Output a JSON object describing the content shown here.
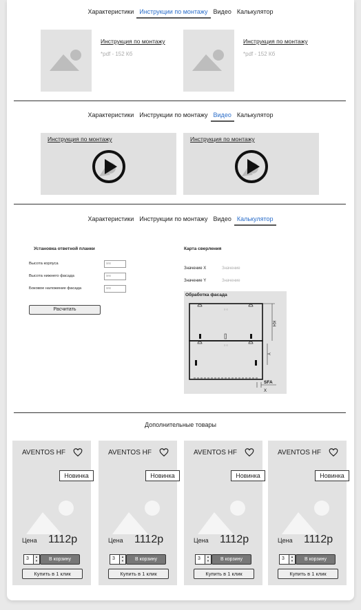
{
  "tabs": [
    "Характеристики",
    "Инструкции по монтажу",
    "Видео",
    "Калькулятор"
  ],
  "section1": {
    "active_tab": 1,
    "docs": [
      {
        "title": "Инструкция по монтажу",
        "meta": "*pdf - 152 Кб"
      },
      {
        "title": "Инструкция по монтажу",
        "meta": "*pdf - 152 Кб"
      }
    ]
  },
  "section2": {
    "active_tab": 2,
    "videos": [
      {
        "title": "Инструкция по монтажу"
      },
      {
        "title": "Инструкция по монтажу"
      }
    ]
  },
  "section3": {
    "active_tab": 3,
    "calc_title": "Установка ответной планки",
    "fields": [
      {
        "label": "Высота корпуса",
        "placeholder": "мм"
      },
      {
        "label": "Высота нижнего фасада",
        "placeholder": "мм"
      },
      {
        "label": "Боковое наложение фасада",
        "placeholder": "мм"
      }
    ],
    "calc_button": "Расчитать",
    "map_title": "Карта сверления",
    "values": [
      {
        "label": "Значение X",
        "value": "Значение"
      },
      {
        "label": "Значение Y",
        "value": "Значение"
      }
    ],
    "diagram": {
      "title": "Обработка фасада",
      "labels": {
        "kh": "KH",
        "y": "Y",
        "sfa": "SFA",
        "x": "X"
      }
    }
  },
  "extra": {
    "title": "Дополнительные товары",
    "products": [
      {
        "name": "AVENTOS HF",
        "badge": "Новинка",
        "price_label": "Цена",
        "price": "1112р",
        "qty": "3",
        "cart": "В корзину",
        "oneclick": "Купить в 1 клик"
      },
      {
        "name": "AVENTOS HF",
        "badge": "Новинка",
        "price_label": "Цена",
        "price": "1112р",
        "qty": "3",
        "cart": "В корзину",
        "oneclick": "Купить в 1 клик"
      },
      {
        "name": "AVENTOS HF",
        "badge": "Новинка",
        "price_label": "Цена",
        "price": "1112р",
        "qty": "3",
        "cart": "В корзину",
        "oneclick": "Купить в 1 клик"
      },
      {
        "name": "AVENTOS HF",
        "badge": "Новинка",
        "price_label": "Цена",
        "price": "1112р",
        "qty": "3",
        "cart": "В корзину",
        "oneclick": "Купить в 1 клик"
      }
    ]
  },
  "colors": {
    "accent": "#2a6dc9",
    "placeholder_bg": "#e2e2e2"
  }
}
